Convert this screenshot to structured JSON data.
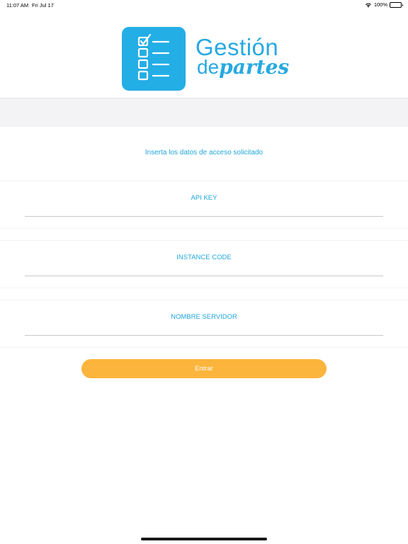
{
  "status_bar": {
    "time": "11:07 AM",
    "date": "Fri Jul 17",
    "battery": "100%"
  },
  "logo": {
    "line1": "Gestión",
    "line2_prefix": "de",
    "line2_emphasis": "partes",
    "color": "#27a9e1"
  },
  "form": {
    "instructions": "Inserta los datos de acceso solicitado",
    "fields": [
      {
        "label": "API KEY",
        "value": ""
      },
      {
        "label": "INSTANCE CODE",
        "value": ""
      },
      {
        "label": "NOMBRE SERVIDOR",
        "value": ""
      }
    ],
    "submit_label": "Entrar"
  },
  "colors": {
    "accent": "#1fa6dc",
    "button": "#fbb53c",
    "band": "#f3f3f5"
  }
}
